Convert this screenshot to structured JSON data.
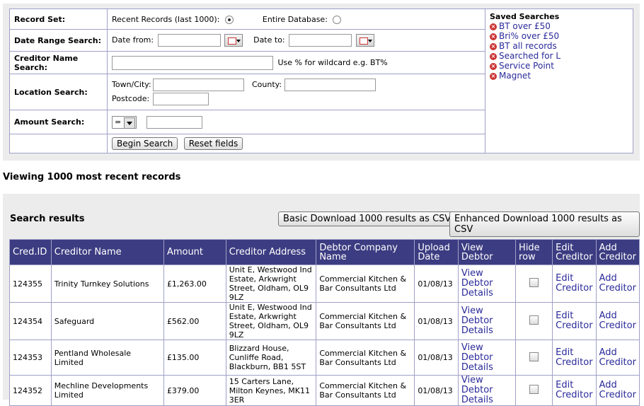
{
  "search_form": {
    "record_set": {
      "label": "Record Set:",
      "option1": "Recent Records (last 1000):",
      "option2": "Entire Database:"
    },
    "date_range": {
      "label": "Date Range Search:",
      "from_label": "Date from:",
      "to_label": "Date to:"
    },
    "creditor_name": {
      "label": "Creditor Name Search:",
      "hint": "Use % for wildcard e.g. BT%"
    },
    "location": {
      "label": "Location Search:",
      "town_label": "Town/City:",
      "county_label": "County:",
      "postcode_label": "Postcode:"
    },
    "amount": {
      "label": "Amount Search:",
      "operator": "="
    },
    "begin_button": "Begin Search",
    "reset_button": "Reset fields"
  },
  "saved_searches": {
    "title": "Saved Searches",
    "items": [
      "BT over £50",
      "Bri% over £50",
      "BT all records",
      "Searched for L",
      "Service Point",
      "Magnet"
    ]
  },
  "viewing_text": "Viewing 1000 most recent records",
  "results": {
    "title": "Search results",
    "basic_download": "Basic Download 1000 results as CSV",
    "enhanced_download": "Enhanced Download 1000 results as CSV",
    "headers": [
      "Cred.ID",
      "Creditor Name",
      "Amount",
      "Creditor Address",
      "Debtor Company Name",
      "Upload Date",
      "View Debtor",
      "Hide row",
      "Edit Creditor",
      "Add Creditor"
    ],
    "rows": [
      {
        "id": "124355",
        "name": "Trinity Turnkey Solutions",
        "amount": "£1,263.00",
        "address": "Unit E, Westwood Ind Estate, Arkwright Street, Oldham, OL9 9LZ",
        "debtor": "Commercial Kitchen & Bar Consultants Ltd",
        "date": "01/08/13",
        "view": "View Debtor Details",
        "edit": "Edit Creditor",
        "add": "Add Creditor"
      },
      {
        "id": "124354",
        "name": "Safeguard",
        "amount": "£562.00",
        "address": "Unit E, Westwood Ind Estate, Arkwright Street, Oldham, OL9 9LZ",
        "debtor": "Commercial Kitchen & Bar Consultants Ltd",
        "date": "01/08/13",
        "view": "View Debtor Details",
        "edit": "Edit Creditor",
        "add": "Add Creditor"
      },
      {
        "id": "124353",
        "name": "Pentland Wholesale Limited",
        "amount": "£135.00",
        "address": "Blizzard House, Cunliffe Road, Blackburn, BB1 5ST",
        "debtor": "Commercial Kitchen & Bar Consultants Ltd",
        "date": "01/08/13",
        "view": "View Debtor Details",
        "edit": "Edit Creditor",
        "add": "Add Creditor"
      },
      {
        "id": "124352",
        "name": "Mechline Developments Limited",
        "amount": "£379.00",
        "address": "15 Carters Lane, Milton Keynes, MK11 3ER",
        "debtor": "Commercial Kitchen & Bar Consultants Ltd",
        "date": "01/08/13",
        "view": "View Debtor Details",
        "edit": "Edit Creditor",
        "add": "Add Creditor"
      }
    ]
  }
}
